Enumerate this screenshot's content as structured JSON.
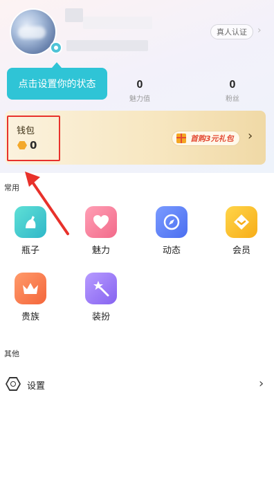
{
  "profile": {
    "realname_label": "真人认证",
    "stats": [
      {
        "value": "0",
        "label": "魅力值"
      },
      {
        "value": "0",
        "label": "粉丝"
      }
    ]
  },
  "tooltip": {
    "text": "点击设置你的状态"
  },
  "wallet": {
    "title": "钱包",
    "balance": "0",
    "promo": "首购3元礼包"
  },
  "sections": {
    "common_title": "常用",
    "other_title": "其他"
  },
  "features": [
    {
      "label": "瓶子",
      "icon": "bottle-icon",
      "color": "#3cc8cf"
    },
    {
      "label": "魅力",
      "icon": "heart-icon",
      "color": "#f47b97"
    },
    {
      "label": "动态",
      "icon": "compass-icon",
      "color": "#5b7ff3"
    },
    {
      "label": "会员",
      "icon": "member-diamond-icon",
      "color": "#f9bb25"
    },
    {
      "label": "贵族",
      "icon": "crown-icon",
      "color": "#f57544"
    },
    {
      "label": "装扮",
      "icon": "magic-wand-icon",
      "color": "#9672f4"
    }
  ],
  "settings": {
    "label": "设置"
  },
  "colors": {
    "highlight": "#e8312b",
    "tooltip": "#2fc4d6",
    "wallet_gold": "#f7e6bf"
  }
}
